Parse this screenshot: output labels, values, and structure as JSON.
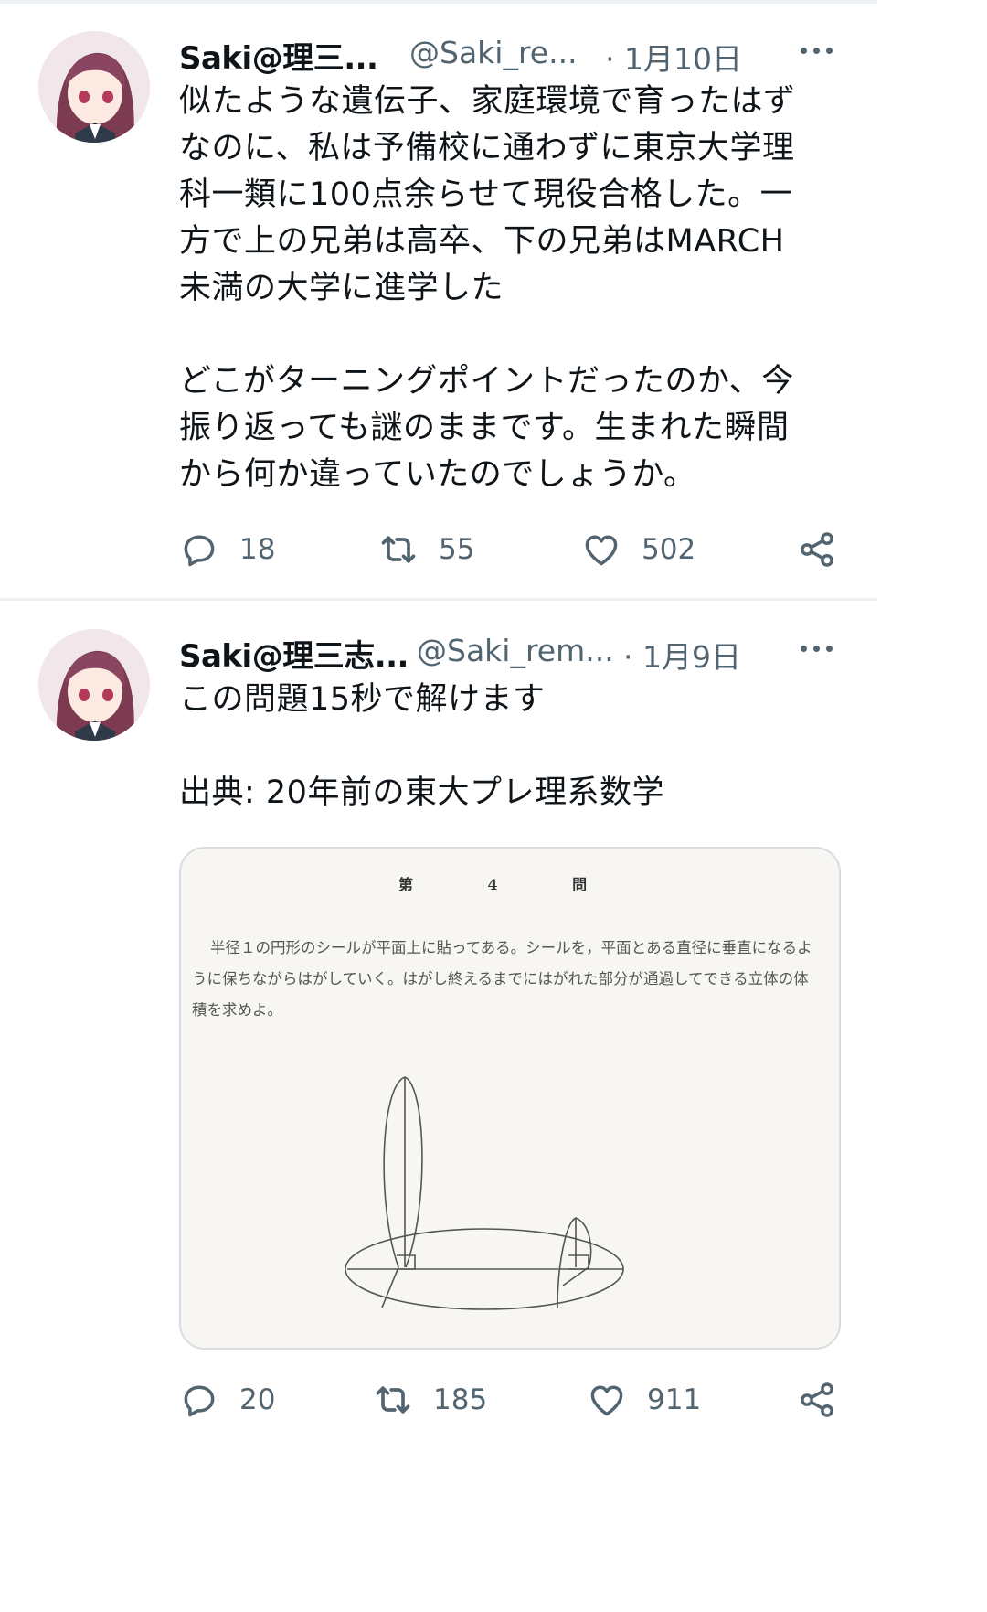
{
  "tweets": [
    {
      "name": "Saki@理三...",
      "handle": "@Saki_re...",
      "date": "· 1月10日",
      "text": "似たような遺伝子、家庭環境で育ったはず\nなのに、私は予備校に通わずに東京大学理\n科一類に100点余らせて現役合格した。一\n方で上の兄弟は高卒、下の兄弟はMARCH\n未満の大学に進学した\n\nどこがターニングポイントだったのか、今\n振り返っても謎のままです。生まれた瞬間\nから何か違っていたのでしょうか。",
      "replies": "18",
      "retweets": "55",
      "likes": "502"
    },
    {
      "name": "Saki@理三志...",
      "handle": "@Saki_rem...",
      "date": "· 1月9日",
      "text": "この問題15秒で解けます\n\n出典: 20年前の東大プレ理系数学",
      "replies": "20",
      "retweets": "185",
      "likes": "911"
    }
  ],
  "media": {
    "problem_title": "第 4 問",
    "problem_text": "半径１の円形のシールが平面上に貼ってある。シールを，平面とある直径に垂直になるように保ちながらはがしていく。はがし終えるまでにはがれた部分が通過してできる立体の体積を求めよ。"
  },
  "icons": {
    "reply": "reply-icon",
    "retweet": "retweet-icon",
    "like": "heart-icon",
    "share": "share-icon",
    "more": "more-icon"
  },
  "colors": {
    "text": "#0f1419",
    "secondary": "#536471",
    "divider": "#eef1f3"
  }
}
